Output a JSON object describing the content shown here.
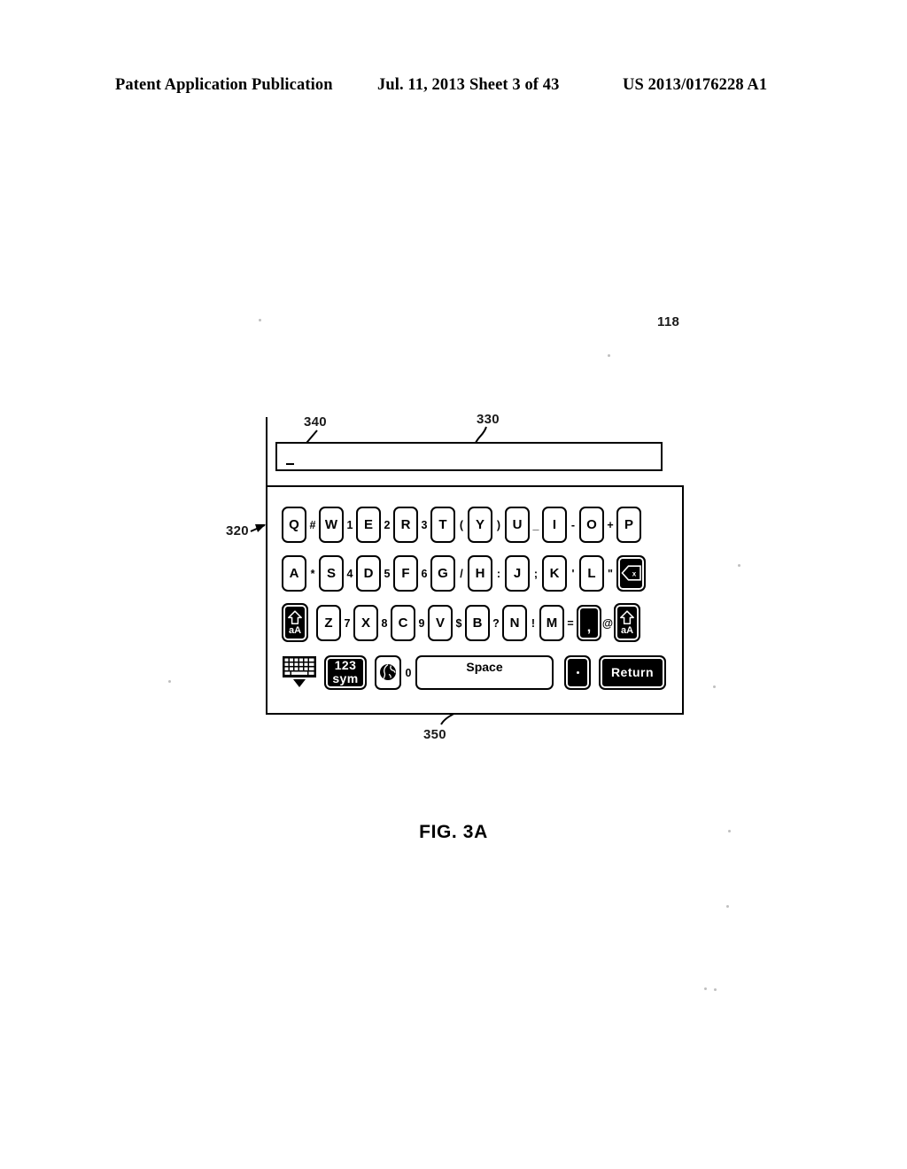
{
  "header": {
    "publication": "Patent Application Publication",
    "date": "Jul. 11, 2013",
    "sheet": "Sheet 3 of 43",
    "patent_number": "US 2013/0176228 A1"
  },
  "figure": {
    "caption": "FIG. 3A",
    "reference_numerals": {
      "device": "118",
      "keyboard": "320",
      "text_field": "330",
      "cursor": "340",
      "space_key": "350"
    }
  },
  "text_field": {
    "value": "",
    "cursor_glyph": "_"
  },
  "keyboard": {
    "rows": [
      {
        "id": "row-1",
        "items": [
          {
            "type": "key",
            "name": "key-q",
            "label": "Q"
          },
          {
            "type": "symbol",
            "name": "symbol-hash",
            "label": "#"
          },
          {
            "type": "key",
            "name": "key-w",
            "label": "W"
          },
          {
            "type": "symbol",
            "name": "symbol-1",
            "label": "1"
          },
          {
            "type": "key",
            "name": "key-e",
            "label": "E"
          },
          {
            "type": "symbol",
            "name": "symbol-2",
            "label": "2"
          },
          {
            "type": "key",
            "name": "key-r",
            "label": "R"
          },
          {
            "type": "symbol",
            "name": "symbol-3",
            "label": "3"
          },
          {
            "type": "key",
            "name": "key-t",
            "label": "T"
          },
          {
            "type": "symbol",
            "name": "symbol-paren-open",
            "label": "("
          },
          {
            "type": "key",
            "name": "key-y",
            "label": "Y"
          },
          {
            "type": "symbol",
            "name": "symbol-paren-close",
            "label": ")"
          },
          {
            "type": "key",
            "name": "key-u",
            "label": "U"
          },
          {
            "type": "symbol",
            "name": "symbol-underscore",
            "label": "_"
          },
          {
            "type": "key",
            "name": "key-i",
            "label": "I"
          },
          {
            "type": "symbol",
            "name": "symbol-hyphen",
            "label": "-"
          },
          {
            "type": "key",
            "name": "key-o",
            "label": "O"
          },
          {
            "type": "symbol",
            "name": "symbol-plus",
            "label": "+"
          },
          {
            "type": "key",
            "name": "key-p",
            "label": "P"
          }
        ]
      },
      {
        "id": "row-2",
        "items": [
          {
            "type": "key",
            "name": "key-a",
            "label": "A"
          },
          {
            "type": "symbol",
            "name": "symbol-asterisk",
            "label": "*"
          },
          {
            "type": "key",
            "name": "key-s",
            "label": "S"
          },
          {
            "type": "symbol",
            "name": "symbol-4",
            "label": "4"
          },
          {
            "type": "key",
            "name": "key-d",
            "label": "D"
          },
          {
            "type": "symbol",
            "name": "symbol-5",
            "label": "5"
          },
          {
            "type": "key",
            "name": "key-f",
            "label": "F"
          },
          {
            "type": "symbol",
            "name": "symbol-6",
            "label": "6"
          },
          {
            "type": "key",
            "name": "key-g",
            "label": "G"
          },
          {
            "type": "symbol",
            "name": "symbol-slash",
            "label": "/"
          },
          {
            "type": "key",
            "name": "key-h",
            "label": "H"
          },
          {
            "type": "symbol",
            "name": "symbol-colon",
            "label": ":"
          },
          {
            "type": "key",
            "name": "key-j",
            "label": "J"
          },
          {
            "type": "symbol",
            "name": "symbol-semicolon",
            "label": ";"
          },
          {
            "type": "key",
            "name": "key-k",
            "label": "K"
          },
          {
            "type": "symbol",
            "name": "symbol-apostrophe",
            "label": "'"
          },
          {
            "type": "key",
            "name": "key-l",
            "label": "L"
          },
          {
            "type": "symbol",
            "name": "symbol-quote",
            "label": "\""
          },
          {
            "type": "backspace",
            "name": "key-backspace",
            "label": "x"
          }
        ]
      },
      {
        "id": "row-3",
        "items": [
          {
            "type": "shift",
            "name": "key-shift-left",
            "label": "aA"
          },
          {
            "type": "key",
            "name": "key-z",
            "label": "Z"
          },
          {
            "type": "symbol",
            "name": "symbol-7",
            "label": "7"
          },
          {
            "type": "key",
            "name": "key-x",
            "label": "X"
          },
          {
            "type": "symbol",
            "name": "symbol-8",
            "label": "8"
          },
          {
            "type": "key",
            "name": "key-c",
            "label": "C"
          },
          {
            "type": "symbol",
            "name": "symbol-9",
            "label": "9"
          },
          {
            "type": "key",
            "name": "key-v",
            "label": "V"
          },
          {
            "type": "symbol",
            "name": "symbol-dollar",
            "label": "$"
          },
          {
            "type": "key",
            "name": "key-b",
            "label": "B"
          },
          {
            "type": "symbol",
            "name": "symbol-question",
            "label": "?"
          },
          {
            "type": "key",
            "name": "key-n",
            "label": "N"
          },
          {
            "type": "symbol",
            "name": "symbol-exclamation",
            "label": "!"
          },
          {
            "type": "key",
            "name": "key-m",
            "label": "M"
          },
          {
            "type": "symbol",
            "name": "symbol-equals",
            "label": "="
          },
          {
            "type": "comma",
            "name": "key-comma",
            "label": ","
          },
          {
            "type": "symbol",
            "name": "symbol-at",
            "label": "@"
          },
          {
            "type": "shift",
            "name": "key-shift-right",
            "label": "aA"
          }
        ]
      },
      {
        "id": "row-4",
        "items": [
          {
            "type": "dismiss",
            "name": "keyboard-dismiss-icon",
            "label": ""
          },
          {
            "type": "sym123",
            "name": "key-123-sym",
            "label_top": "123",
            "label_bottom": "sym"
          },
          {
            "type": "globe",
            "name": "key-globe",
            "label": ""
          },
          {
            "type": "symbol",
            "name": "symbol-0",
            "label": "0"
          },
          {
            "type": "space",
            "name": "key-space",
            "label": "Space"
          },
          {
            "type": "period",
            "name": "key-period",
            "label": "."
          },
          {
            "type": "return",
            "name": "key-return",
            "label": "Return"
          }
        ]
      }
    ]
  }
}
